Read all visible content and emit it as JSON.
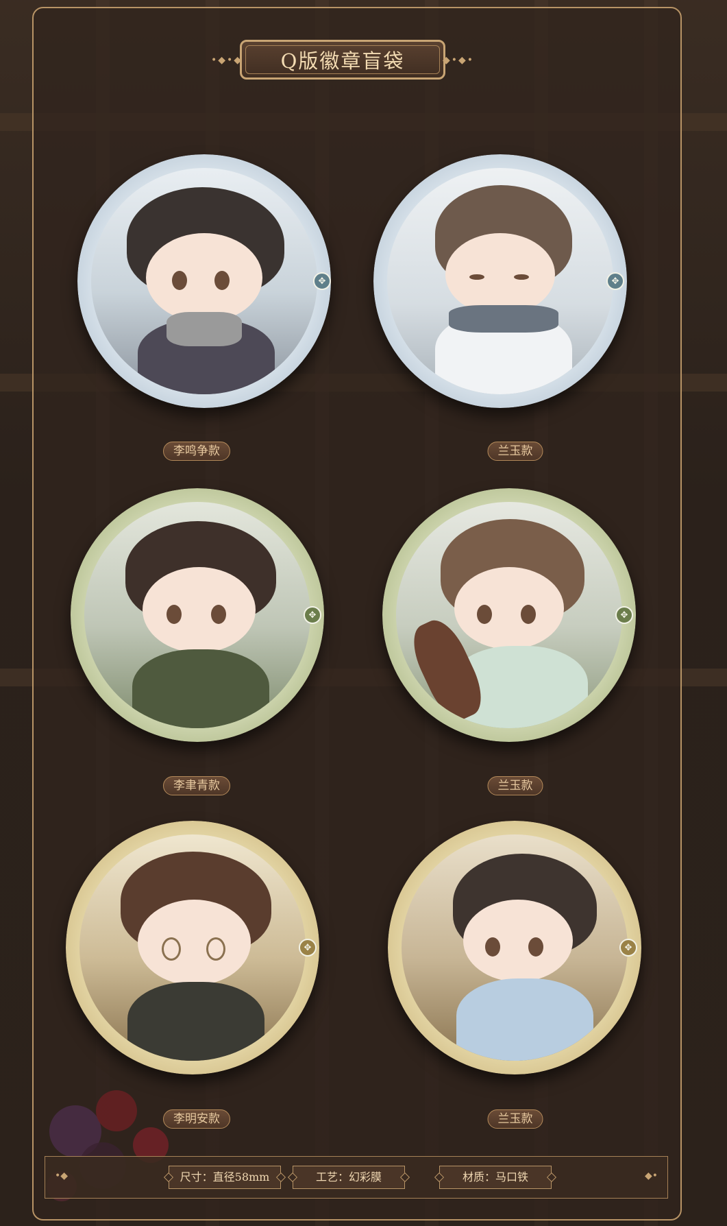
{
  "title": "Q版徽章盲袋",
  "badges": [
    {
      "label": "李鸣争款",
      "theme": "blue"
    },
    {
      "label": "兰玉款",
      "theme": "blue"
    },
    {
      "label": "李聿青款",
      "theme": "green"
    },
    {
      "label": "兰玉款",
      "theme": "green"
    },
    {
      "label": "李明安款",
      "theme": "gold"
    },
    {
      "label": "兰玉款",
      "theme": "gold"
    }
  ],
  "specs": {
    "size": "尺寸：直径58mm",
    "craft": "工艺：幻彩膜",
    "material": "材质：马口铁"
  },
  "colors": {
    "accent": "#b89466",
    "blue_rim": "#aebfd0",
    "green_rim": "#a7b37c",
    "gold_rim": "#cdb57a"
  }
}
